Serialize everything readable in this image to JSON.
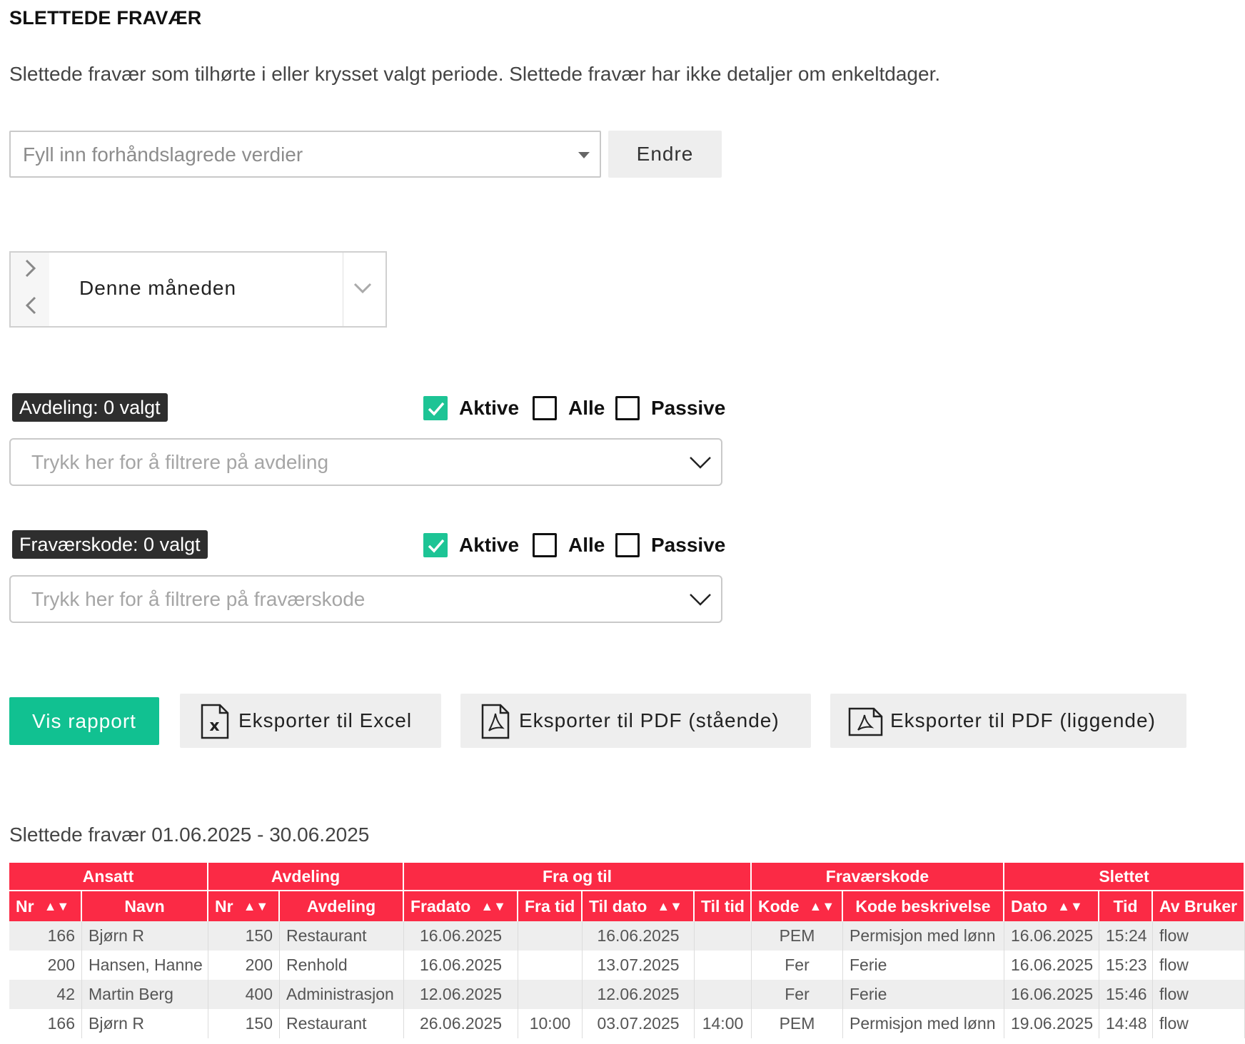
{
  "page": {
    "title": "SLETTEDE FRAVÆR",
    "description": "Slettede fravær som tilhørte i eller krysset valgt periode. Slettede fravær har ikke detaljer om enkeltdager."
  },
  "preset": {
    "placeholder": "Fyll inn forhåndslagrede verdier",
    "change_label": "Endre"
  },
  "period": {
    "label": "Denne måneden"
  },
  "filters": {
    "avdeling": {
      "badge": "Avdeling: 0 valgt",
      "placeholder": "Trykk her for å filtrere på avdeling",
      "active_label": "Aktive",
      "all_label": "Alle",
      "passive_label": "Passive"
    },
    "fravaerskode": {
      "badge": "Fraværskode: 0 valgt",
      "placeholder": "Trykk her for å filtrere på fraværskode",
      "active_label": "Aktive",
      "all_label": "Alle",
      "passive_label": "Passive"
    }
  },
  "actions": {
    "show_report": "Vis rapport",
    "export_excel": "Eksporter til Excel",
    "export_pdf_portrait": "Eksporter til PDF (stående)",
    "export_pdf_landscape": "Eksporter til PDF (liggende)"
  },
  "report": {
    "title": "Slettede fravær 01.06.2025 - 30.06.2025",
    "groups": [
      "Ansatt",
      "Avdeling",
      "Fra og til",
      "Fraværskode",
      "Slettet"
    ],
    "columns": [
      "Nr",
      "Navn",
      "Nr",
      "Avdeling",
      "Fradato",
      "Fra tid",
      "Til dato",
      "Til tid",
      "Kode",
      "Kode beskrivelse",
      "Dato",
      "Tid",
      "Av Bruker"
    ],
    "sort_glyph": "▲▼",
    "rows": [
      [
        "166",
        "Bjørn R",
        "150",
        "Restaurant",
        "16.06.2025",
        "",
        "16.06.2025",
        "",
        "PEM",
        "Permisjon med lønn",
        "16.06.2025",
        "15:24",
        "flow"
      ],
      [
        "200",
        "Hansen, Hanne",
        "200",
        "Renhold",
        "16.06.2025",
        "",
        "13.07.2025",
        "",
        "Fer",
        "Ferie",
        "16.06.2025",
        "15:23",
        "flow"
      ],
      [
        "42",
        "Martin Berg",
        "400",
        "Administrasjon",
        "12.06.2025",
        "",
        "12.06.2025",
        "",
        "Fer",
        "Ferie",
        "16.06.2025",
        "15:46",
        "flow"
      ],
      [
        "166",
        "Bjørn R",
        "150",
        "Restaurant",
        "26.06.2025",
        "10:00",
        "03.07.2025",
        "14:00",
        "PEM",
        "Permisjon med lønn",
        "19.06.2025",
        "14:48",
        "flow"
      ]
    ]
  },
  "colors": {
    "accent": "#11c191",
    "header_red": "#fb2a45",
    "checkbox_on": "#1dc495"
  }
}
